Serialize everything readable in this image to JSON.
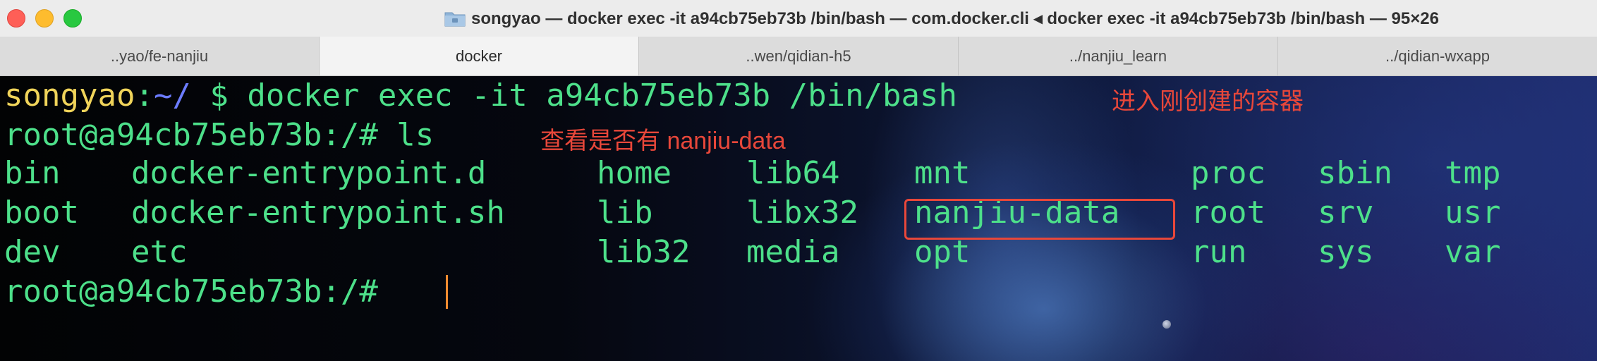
{
  "window": {
    "title": "songyao — docker exec -it a94cb75eb73b /bin/bash — com.docker.cli ◂ docker exec -it a94cb75eb73b /bin/bash — 95×26"
  },
  "tabs": [
    {
      "label": "..yao/fe-nanjiu",
      "active": false
    },
    {
      "label": "docker",
      "active": true
    },
    {
      "label": "..wen/qidian-h5",
      "active": false
    },
    {
      "label": "../nanjiu_learn",
      "active": false
    },
    {
      "label": "../qidian-wxapp",
      "active": false
    }
  ],
  "terminal": {
    "prompt1": {
      "user": "songyao",
      "sep": ":",
      "path": "~/",
      "rest": " $ docker exec -it a94cb75eb73b /bin/bash"
    },
    "prompt2": "root@a94cb75eb73b:/# ls",
    "ls_rows": [
      [
        "bin",
        "docker-entrypoint.d",
        "home",
        "lib64",
        "mnt",
        "proc",
        "sbin",
        "tmp"
      ],
      [
        "boot",
        "docker-entrypoint.sh",
        "lib",
        "libx32",
        "nanjiu-data",
        "root",
        "srv",
        "usr"
      ],
      [
        "dev",
        "etc",
        "",
        "lib32",
        "media",
        "opt",
        "run",
        "sys",
        "var"
      ]
    ],
    "prompt3": "root@a94cb75eb73b:/#"
  },
  "annotations": {
    "enter_container": "进入刚创建的容器",
    "check_data": "查看是否有 nanjiu-data"
  },
  "colors": {
    "terminal_text": "#4de08a",
    "user": "#f0d45a",
    "path": "#6c7cff",
    "annotation": "#e8473a",
    "cursor": "#f28b30"
  }
}
